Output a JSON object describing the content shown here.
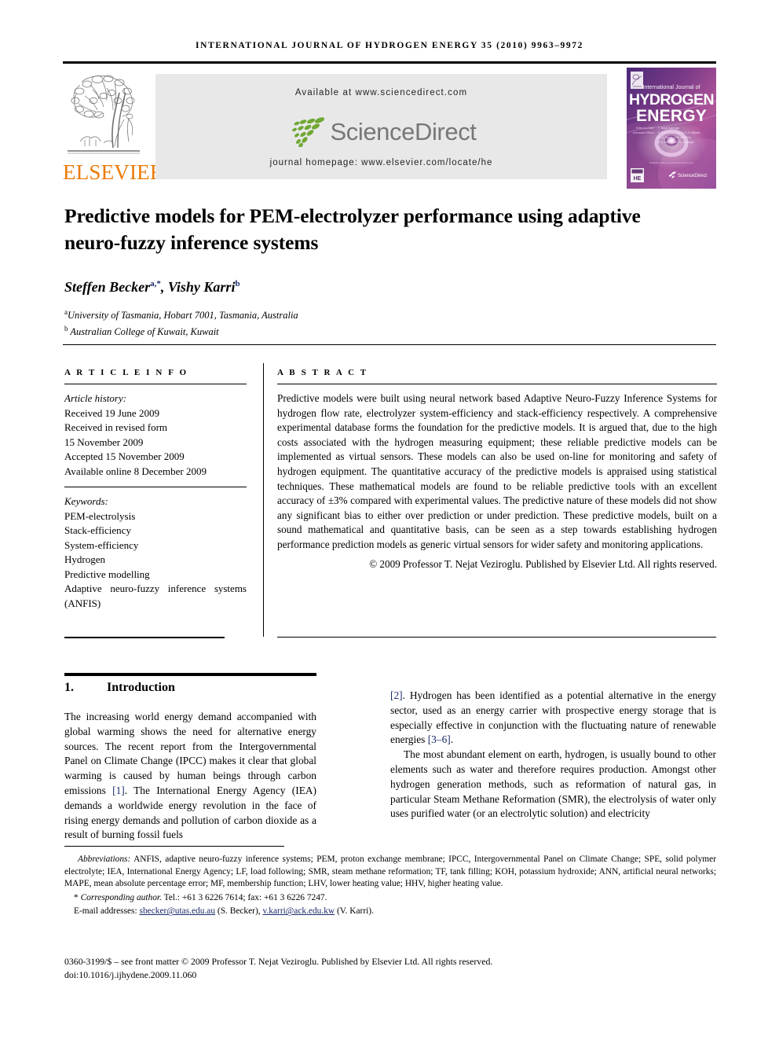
{
  "running_head": "INTERNATIONAL JOURNAL OF HYDROGEN ENERGY 35 (2010) 9963–9972",
  "masthead": {
    "publisher_name": "ELSEVIER",
    "available_at": "Available at www.sciencedirect.com",
    "sciencedirect_word": "ScienceDirect",
    "journal_homepage": "journal homepage: www.elsevier.com/locate/he",
    "cover": {
      "kicker": "International Journal of",
      "line1": "HYDROGEN",
      "line2": "ENERGY",
      "editor_label": "Editor-in-Chief",
      "editor_name": "T. Nejat Veziroglu",
      "assoc_label": "Associate Editors",
      "assoc_names": "F. Barbir, S.A. Sherif, D.-H. Mitrani,\nW.-A. Amos, J.W. Sheffield,\nS.A. Sherif and T.N. Veziroglu",
      "badge": "HE",
      "sciencedirect_mark": "ScienceDirect"
    }
  },
  "article": {
    "title": "Predictive models for PEM-electrolyzer performance using adaptive neuro-fuzzy inference systems",
    "authors_plain": "Steffen Becker",
    "author1": "Steffen Becker",
    "author1_sup": "a,*",
    "author2": "Vishy Karri",
    "author2_sup": "b",
    "affiliation_a_sup": "a",
    "affiliation_a": "University of Tasmania, Hobart 7001, Tasmania, Australia",
    "affiliation_b_sup": "b",
    "affiliation_b": "Australian College of Kuwait, Kuwait"
  },
  "article_info": {
    "heading": "A R T I C L E   I N F O",
    "history_label": "Article history:",
    "history": [
      "Received 19 June 2009",
      "Received in revised form",
      "15 November 2009",
      "Accepted 15 November 2009",
      "Available online 8 December 2009"
    ],
    "keywords_label": "Keywords:",
    "keywords": [
      "PEM-electrolysis",
      "Stack-efficiency",
      "System-efficiency",
      "Hydrogen",
      "Predictive modelling"
    ],
    "keyword_last": "Adaptive neuro-fuzzy inference systems (ANFIS)"
  },
  "abstract": {
    "heading": "A B S T R A C T",
    "body": "Predictive models were built using neural network based Adaptive Neuro-Fuzzy Inference Systems for hydrogen flow rate, electrolyzer system-efficiency and stack-efficiency respectively. A comprehensive experimental database forms the foundation for the predictive models. It is argued that, due to the high costs associated with the hydrogen measuring equipment; these reliable predictive models can be implemented as virtual sensors. These models can also be used on-line for monitoring and safety of hydrogen equipment. The quantitative accuracy of the predictive models is appraised using statistical techniques. These mathematical models are found to be reliable predictive tools with an excellent accuracy of ±3% compared with experimental values. The predictive nature of these models did not show any significant bias to either over prediction or under prediction. These predictive models, built on a sound mathematical and quantitative basis, can be seen as a step towards establishing hydrogen performance prediction models as generic virtual sensors for wider safety and monitoring applications.",
    "copyright": "© 2009 Professor T. Nejat Veziroglu. Published by Elsevier Ltd. All rights reserved."
  },
  "body": {
    "section_number": "1.",
    "section_title": "Introduction",
    "left_para1_a": "The increasing world energy demand accompanied with global warming shows the need for alternative energy sources. The recent report from the Intergovernmental Panel on Climate Change (IPCC) makes it clear that global warming is caused by human beings through carbon emissions ",
    "left_ref1": "[1]",
    "left_para1_b": ". The International Energy Agency (IEA) demands a worldwide energy revolution in the face of rising energy demands and pollution of carbon dioxide as a result of burning fossil fuels",
    "right_ref2": "[2]",
    "right_para1_a": ". Hydrogen has been identified as a potential alternative in the energy sector, used as an energy carrier with prospective energy storage that is especially effective in conjunction with the fluctuating nature of renewable energies ",
    "right_ref3": "[3–6]",
    "right_para1_b": ".",
    "right_para2": "The most abundant element on earth, hydrogen, is usually bound to other elements such as water and therefore requires production. Amongst other hydrogen generation methods, such as reformation of natural gas, in particular Steam Methane Reformation (SMR), the electrolysis of water only uses purified water (or an electrolytic solution) and electricity"
  },
  "footnotes": {
    "abbrev_label": "Abbreviations:",
    "abbrev_body": " ANFIS, adaptive neuro-fuzzy inference systems; PEM, proton exchange membrane; IPCC, Intergovernmental Panel on Climate Change; SPE, solid polymer electrolyte; IEA, International Energy Agency; LF, load following; SMR, steam methane reformation; TF, tank filling; KOH, potassium hydroxide; ANN, artificial neural networks; MAPE, mean absolute percentage error; MF, membership function; LHV, lower heating value; HHV, higher heating value.",
    "corresponding_marker": "*",
    "corresponding_label": "Corresponding author.",
    "corresponding_detail": " Tel.: +61 3 6226 7614; fax: +61 3 6226 7247.",
    "email_label": "E-mail addresses:",
    "email1": "sbecker@utas.edu.au",
    "email1_owner": " (S. Becker),",
    "email2": "v.karri@ack.edu.kw",
    "email2_owner": " (V. Karri)."
  },
  "footer": {
    "issn_line": "0360-3199/$ – see front matter © 2009 Professor T. Nejat Veziroglu. Published by Elsevier Ltd. All rights reserved.",
    "doi_line": "doi:10.1016/j.ijhydene.2009.11.060"
  },
  "colors": {
    "elsevier_orange": "#EC7A08",
    "sciencedirect_green": "#6FA832",
    "sciencedirect_gray": "#77777a",
    "link_navy": "#1b2a6b",
    "banner_gray": "#e8e8e8"
  }
}
